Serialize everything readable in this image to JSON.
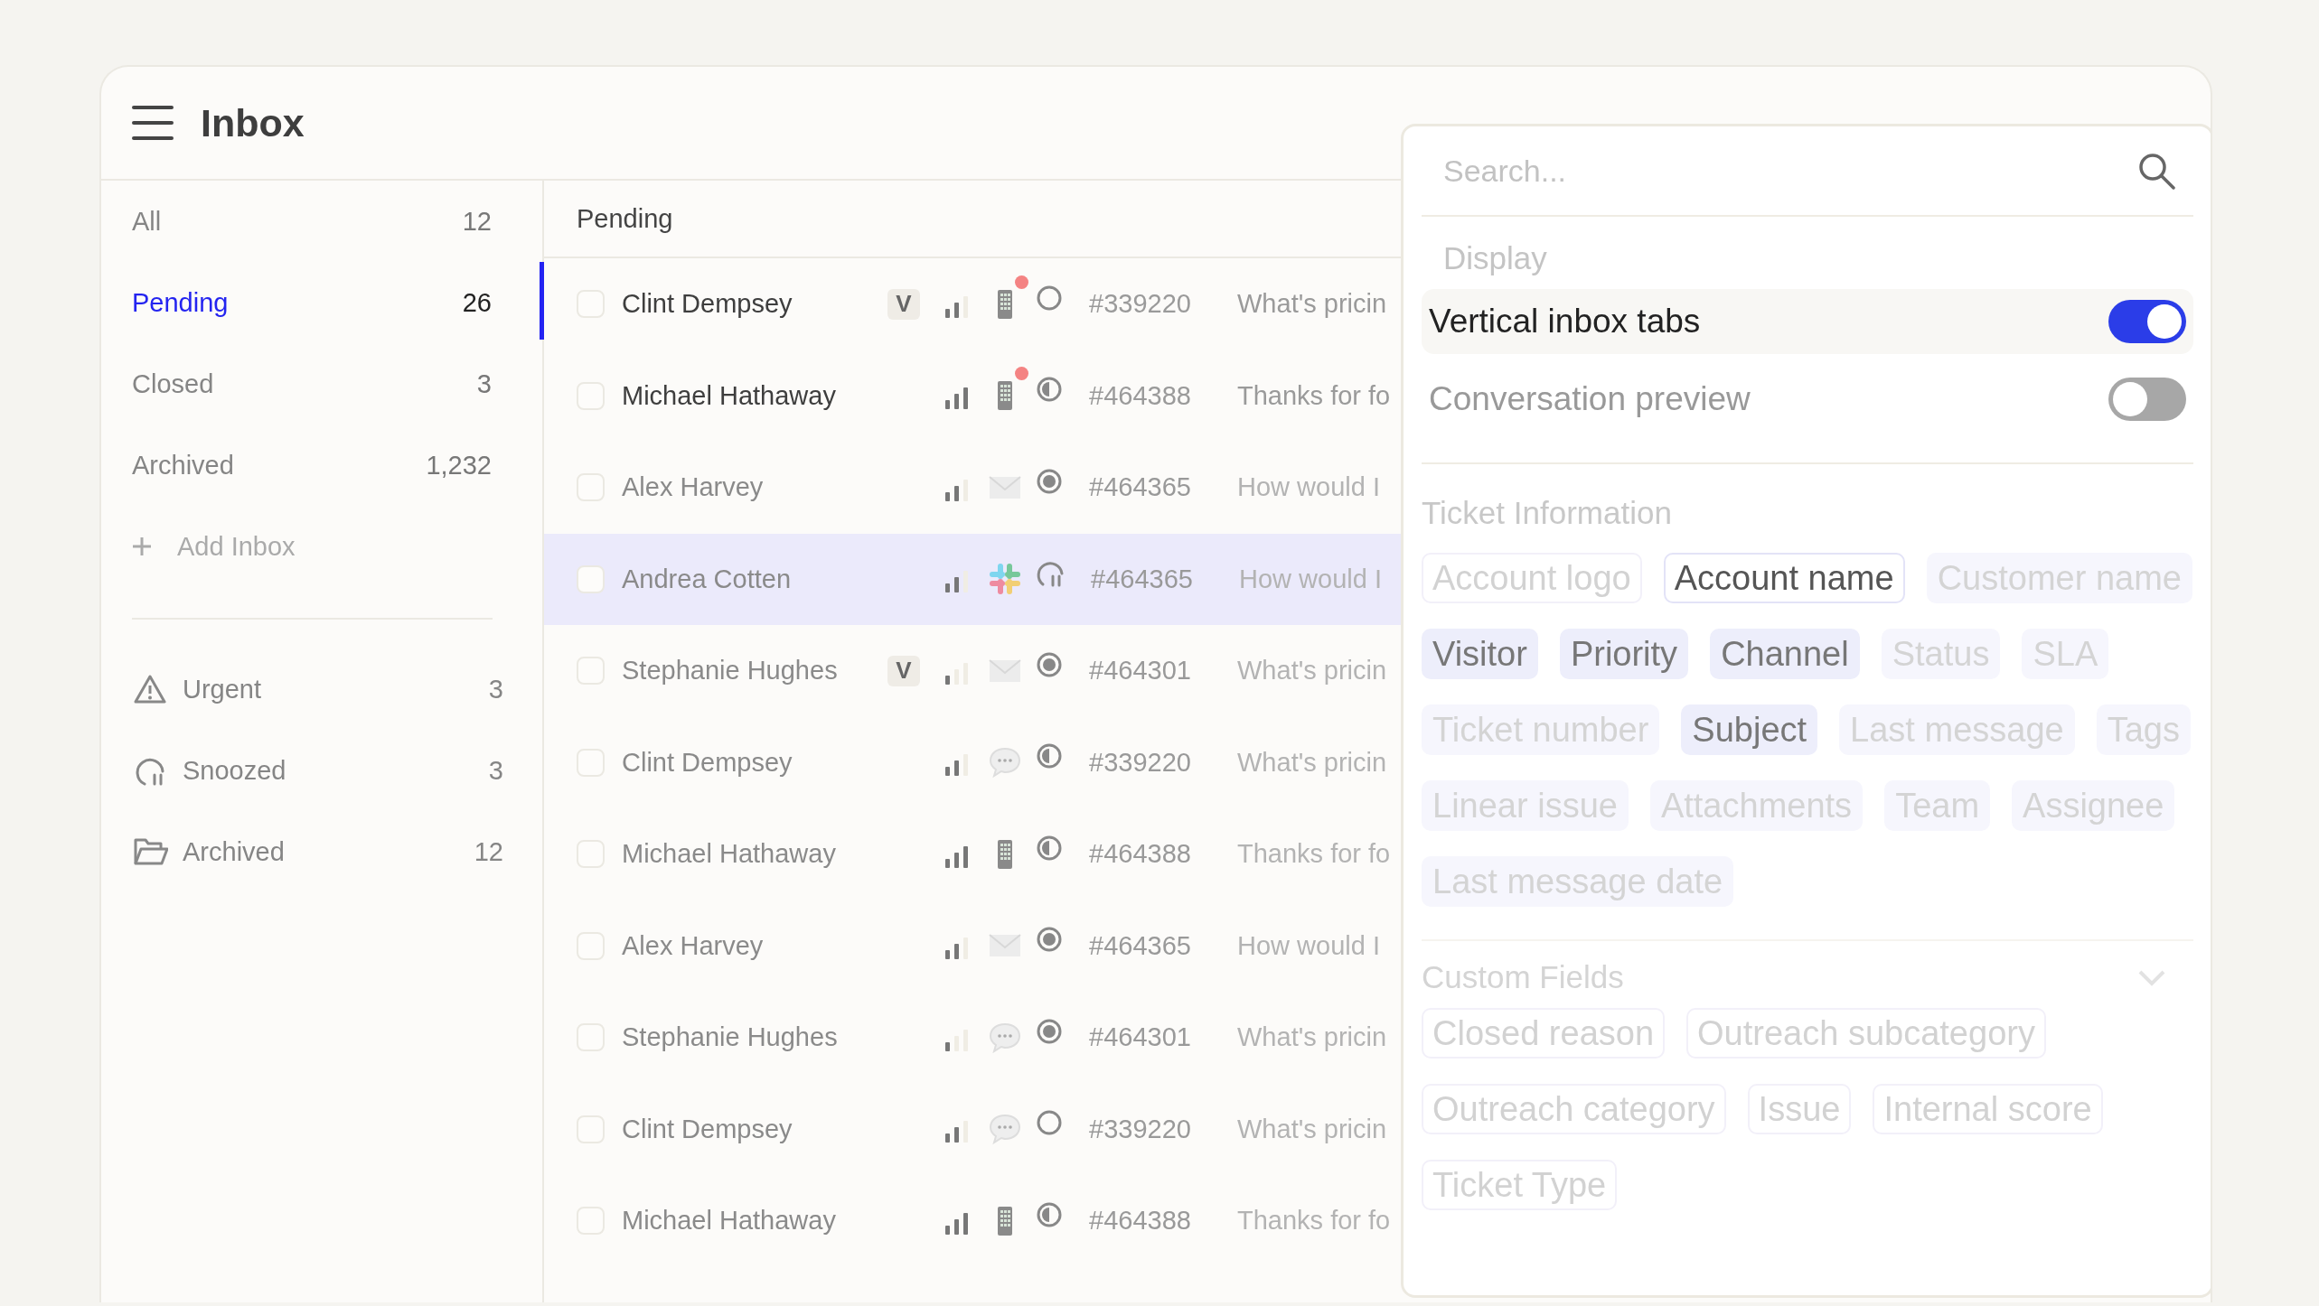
{
  "header": {
    "title": "Inbox"
  },
  "sidebar": {
    "inboxes": [
      {
        "label": "All",
        "count": "12",
        "selected": false
      },
      {
        "label": "Pending",
        "count": "26",
        "selected": true
      },
      {
        "label": "Closed",
        "count": "3",
        "selected": false
      },
      {
        "label": "Archived",
        "count": "1,232",
        "selected": false
      }
    ],
    "add_inbox": {
      "label": "Add Inbox"
    },
    "views": [
      {
        "kind": "urgent",
        "label": "Urgent",
        "count": "3"
      },
      {
        "kind": "snoozed",
        "label": "Snoozed",
        "count": "3"
      },
      {
        "kind": "archived",
        "label": "Archived",
        "count": "12"
      }
    ]
  },
  "list": {
    "heading": "Pending",
    "rows": [
      {
        "name": "Clint Dempsey",
        "unread": true,
        "badge": "V",
        "priority": {
          "kind": "medium"
        },
        "channel": {
          "kind": "phone",
          "notify": true
        },
        "status": {
          "kind": "open"
        },
        "ticket": "#339220",
        "preview": "What's pricin",
        "selected": false
      },
      {
        "name": "Michael Hathaway",
        "unread": true,
        "priority": {
          "kind": "high"
        },
        "channel": {
          "kind": "phone",
          "notify": true
        },
        "status": {
          "kind": "half"
        },
        "ticket": "#464388",
        "preview": "Thanks for fo",
        "selected": false
      },
      {
        "name": "Alex Harvey",
        "unread": false,
        "priority": {
          "kind": "medium"
        },
        "channel": {
          "kind": "email",
          "notify": false
        },
        "status": {
          "kind": "dot"
        },
        "ticket": "#464365",
        "preview": "How would I",
        "selected": false
      },
      {
        "name": "Andrea Cotten",
        "unread": false,
        "priority": {
          "kind": "medium"
        },
        "channel": {
          "kind": "slack",
          "notify": false
        },
        "status": {
          "kind": "snoozed"
        },
        "ticket": "#464365",
        "preview": "How would I",
        "selected": true
      },
      {
        "name": "Stephanie Hughes",
        "unread": false,
        "badge": "V",
        "priority": {
          "kind": "low"
        },
        "channel": {
          "kind": "email",
          "notify": false
        },
        "status": {
          "kind": "dot"
        },
        "ticket": "#464301",
        "preview": "What's pricin",
        "selected": false
      },
      {
        "name": "Clint Dempsey",
        "unread": false,
        "priority": {
          "kind": "medium"
        },
        "channel": {
          "kind": "chat",
          "notify": false
        },
        "status": {
          "kind": "half"
        },
        "ticket": "#339220",
        "preview": "What's pricin",
        "selected": false
      },
      {
        "name": "Michael Hathaway",
        "unread": false,
        "priority": {
          "kind": "high"
        },
        "channel": {
          "kind": "phone",
          "notify": false
        },
        "status": {
          "kind": "half"
        },
        "ticket": "#464388",
        "preview": "Thanks for fo",
        "selected": false
      },
      {
        "name": "Alex Harvey",
        "unread": false,
        "priority": {
          "kind": "medium"
        },
        "channel": {
          "kind": "email",
          "notify": false
        },
        "status": {
          "kind": "dot"
        },
        "ticket": "#464365",
        "preview": "How would I",
        "selected": false
      },
      {
        "name": "Stephanie Hughes",
        "unread": false,
        "priority": {
          "kind": "low"
        },
        "channel": {
          "kind": "chat",
          "notify": false
        },
        "status": {
          "kind": "dot"
        },
        "ticket": "#464301",
        "preview": "What's pricin",
        "selected": false
      },
      {
        "name": "Clint Dempsey",
        "unread": false,
        "priority": {
          "kind": "medium"
        },
        "channel": {
          "kind": "chat",
          "notify": false
        },
        "status": {
          "kind": "open"
        },
        "ticket": "#339220",
        "preview": "What's pricin",
        "selected": false
      },
      {
        "name": "Michael Hathaway",
        "unread": false,
        "priority": {
          "kind": "high"
        },
        "channel": {
          "kind": "phone",
          "notify": false
        },
        "status": {
          "kind": "half"
        },
        "ticket": "#464388",
        "preview": "Thanks for fo",
        "selected": false
      }
    ]
  },
  "panel": {
    "search": {
      "placeholder": "Search..."
    },
    "display": {
      "heading": "Display",
      "toggles": [
        {
          "label": "Vertical inbox tabs",
          "on": true,
          "hovered": true
        },
        {
          "label": "Conversation preview",
          "on": false,
          "hovered": false
        }
      ]
    },
    "ticket_information": {
      "heading": "Ticket Information",
      "chips": [
        {
          "label": "Account logo",
          "kind": "outline",
          "selected": false
        },
        {
          "label": "Account name",
          "kind": "outline",
          "selected": true
        },
        {
          "label": "Customer name",
          "kind": "filled",
          "selected": false
        },
        {
          "label": "Visitor",
          "kind": "filled",
          "selected": true
        },
        {
          "label": "Priority",
          "kind": "filled",
          "selected": true
        },
        {
          "label": "Channel",
          "kind": "filled",
          "selected": true
        },
        {
          "label": "Status",
          "kind": "filled",
          "selected": false
        },
        {
          "label": "SLA",
          "kind": "filled",
          "selected": false
        },
        {
          "label": "Ticket number",
          "kind": "filled",
          "selected": false
        },
        {
          "label": "Subject",
          "kind": "filled",
          "selected": true
        },
        {
          "label": "Last message",
          "kind": "filled",
          "selected": false
        },
        {
          "label": "Tags",
          "kind": "filled",
          "selected": false
        },
        {
          "label": "Linear issue",
          "kind": "filled",
          "selected": false
        },
        {
          "label": "Attachments",
          "kind": "filled",
          "selected": false
        },
        {
          "label": "Team",
          "kind": "filled",
          "selected": false
        },
        {
          "label": "Assignee",
          "kind": "filled",
          "selected": false
        },
        {
          "label": "Last message date",
          "kind": "filled",
          "selected": false
        }
      ]
    },
    "custom_fields": {
      "heading": "Custom Fields",
      "expanded": false,
      "chips": [
        {
          "label": "Closed reason",
          "kind": "outline",
          "selected": false
        },
        {
          "label": "Outreach subcategory",
          "kind": "outline",
          "selected": false
        },
        {
          "label": "Outreach category",
          "kind": "outline",
          "selected": false
        },
        {
          "label": "Issue",
          "kind": "outline",
          "selected": false
        },
        {
          "label": "Internal score",
          "kind": "outline",
          "selected": false
        },
        {
          "label": "Ticket Type",
          "kind": "outline",
          "selected": false
        }
      ]
    }
  }
}
